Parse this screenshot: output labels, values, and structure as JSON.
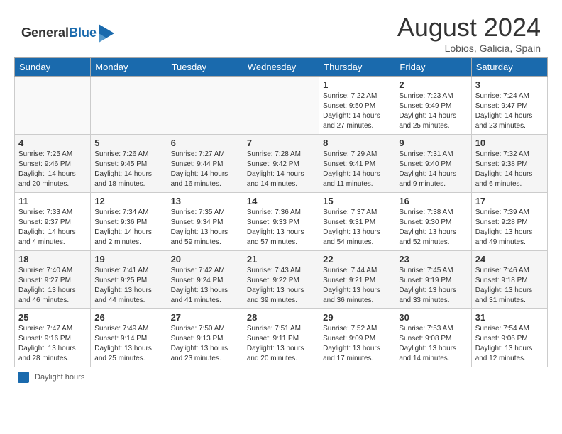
{
  "header": {
    "logo_general": "General",
    "logo_blue": "Blue",
    "month_year": "August 2024",
    "location": "Lobios, Galicia, Spain"
  },
  "calendar": {
    "days_of_week": [
      "Sunday",
      "Monday",
      "Tuesday",
      "Wednesday",
      "Thursday",
      "Friday",
      "Saturday"
    ],
    "weeks": [
      [
        {
          "day": "",
          "info": ""
        },
        {
          "day": "",
          "info": ""
        },
        {
          "day": "",
          "info": ""
        },
        {
          "day": "",
          "info": ""
        },
        {
          "day": "1",
          "info": "Sunrise: 7:22 AM\nSunset: 9:50 PM\nDaylight: 14 hours and 27 minutes."
        },
        {
          "day": "2",
          "info": "Sunrise: 7:23 AM\nSunset: 9:49 PM\nDaylight: 14 hours and 25 minutes."
        },
        {
          "day": "3",
          "info": "Sunrise: 7:24 AM\nSunset: 9:47 PM\nDaylight: 14 hours and 23 minutes."
        }
      ],
      [
        {
          "day": "4",
          "info": "Sunrise: 7:25 AM\nSunset: 9:46 PM\nDaylight: 14 hours and 20 minutes."
        },
        {
          "day": "5",
          "info": "Sunrise: 7:26 AM\nSunset: 9:45 PM\nDaylight: 14 hours and 18 minutes."
        },
        {
          "day": "6",
          "info": "Sunrise: 7:27 AM\nSunset: 9:44 PM\nDaylight: 14 hours and 16 minutes."
        },
        {
          "day": "7",
          "info": "Sunrise: 7:28 AM\nSunset: 9:42 PM\nDaylight: 14 hours and 14 minutes."
        },
        {
          "day": "8",
          "info": "Sunrise: 7:29 AM\nSunset: 9:41 PM\nDaylight: 14 hours and 11 minutes."
        },
        {
          "day": "9",
          "info": "Sunrise: 7:31 AM\nSunset: 9:40 PM\nDaylight: 14 hours and 9 minutes."
        },
        {
          "day": "10",
          "info": "Sunrise: 7:32 AM\nSunset: 9:38 PM\nDaylight: 14 hours and 6 minutes."
        }
      ],
      [
        {
          "day": "11",
          "info": "Sunrise: 7:33 AM\nSunset: 9:37 PM\nDaylight: 14 hours and 4 minutes."
        },
        {
          "day": "12",
          "info": "Sunrise: 7:34 AM\nSunset: 9:36 PM\nDaylight: 14 hours and 2 minutes."
        },
        {
          "day": "13",
          "info": "Sunrise: 7:35 AM\nSunset: 9:34 PM\nDaylight: 13 hours and 59 minutes."
        },
        {
          "day": "14",
          "info": "Sunrise: 7:36 AM\nSunset: 9:33 PM\nDaylight: 13 hours and 57 minutes."
        },
        {
          "day": "15",
          "info": "Sunrise: 7:37 AM\nSunset: 9:31 PM\nDaylight: 13 hours and 54 minutes."
        },
        {
          "day": "16",
          "info": "Sunrise: 7:38 AM\nSunset: 9:30 PM\nDaylight: 13 hours and 52 minutes."
        },
        {
          "day": "17",
          "info": "Sunrise: 7:39 AM\nSunset: 9:28 PM\nDaylight: 13 hours and 49 minutes."
        }
      ],
      [
        {
          "day": "18",
          "info": "Sunrise: 7:40 AM\nSunset: 9:27 PM\nDaylight: 13 hours and 46 minutes."
        },
        {
          "day": "19",
          "info": "Sunrise: 7:41 AM\nSunset: 9:25 PM\nDaylight: 13 hours and 44 minutes."
        },
        {
          "day": "20",
          "info": "Sunrise: 7:42 AM\nSunset: 9:24 PM\nDaylight: 13 hours and 41 minutes."
        },
        {
          "day": "21",
          "info": "Sunrise: 7:43 AM\nSunset: 9:22 PM\nDaylight: 13 hours and 39 minutes."
        },
        {
          "day": "22",
          "info": "Sunrise: 7:44 AM\nSunset: 9:21 PM\nDaylight: 13 hours and 36 minutes."
        },
        {
          "day": "23",
          "info": "Sunrise: 7:45 AM\nSunset: 9:19 PM\nDaylight: 13 hours and 33 minutes."
        },
        {
          "day": "24",
          "info": "Sunrise: 7:46 AM\nSunset: 9:18 PM\nDaylight: 13 hours and 31 minutes."
        }
      ],
      [
        {
          "day": "25",
          "info": "Sunrise: 7:47 AM\nSunset: 9:16 PM\nDaylight: 13 hours and 28 minutes."
        },
        {
          "day": "26",
          "info": "Sunrise: 7:49 AM\nSunset: 9:14 PM\nDaylight: 13 hours and 25 minutes."
        },
        {
          "day": "27",
          "info": "Sunrise: 7:50 AM\nSunset: 9:13 PM\nDaylight: 13 hours and 23 minutes."
        },
        {
          "day": "28",
          "info": "Sunrise: 7:51 AM\nSunset: 9:11 PM\nDaylight: 13 hours and 20 minutes."
        },
        {
          "day": "29",
          "info": "Sunrise: 7:52 AM\nSunset: 9:09 PM\nDaylight: 13 hours and 17 minutes."
        },
        {
          "day": "30",
          "info": "Sunrise: 7:53 AM\nSunset: 9:08 PM\nDaylight: 13 hours and 14 minutes."
        },
        {
          "day": "31",
          "info": "Sunrise: 7:54 AM\nSunset: 9:06 PM\nDaylight: 13 hours and 12 minutes."
        }
      ]
    ]
  },
  "footer": {
    "legend_label": "Daylight hours"
  }
}
